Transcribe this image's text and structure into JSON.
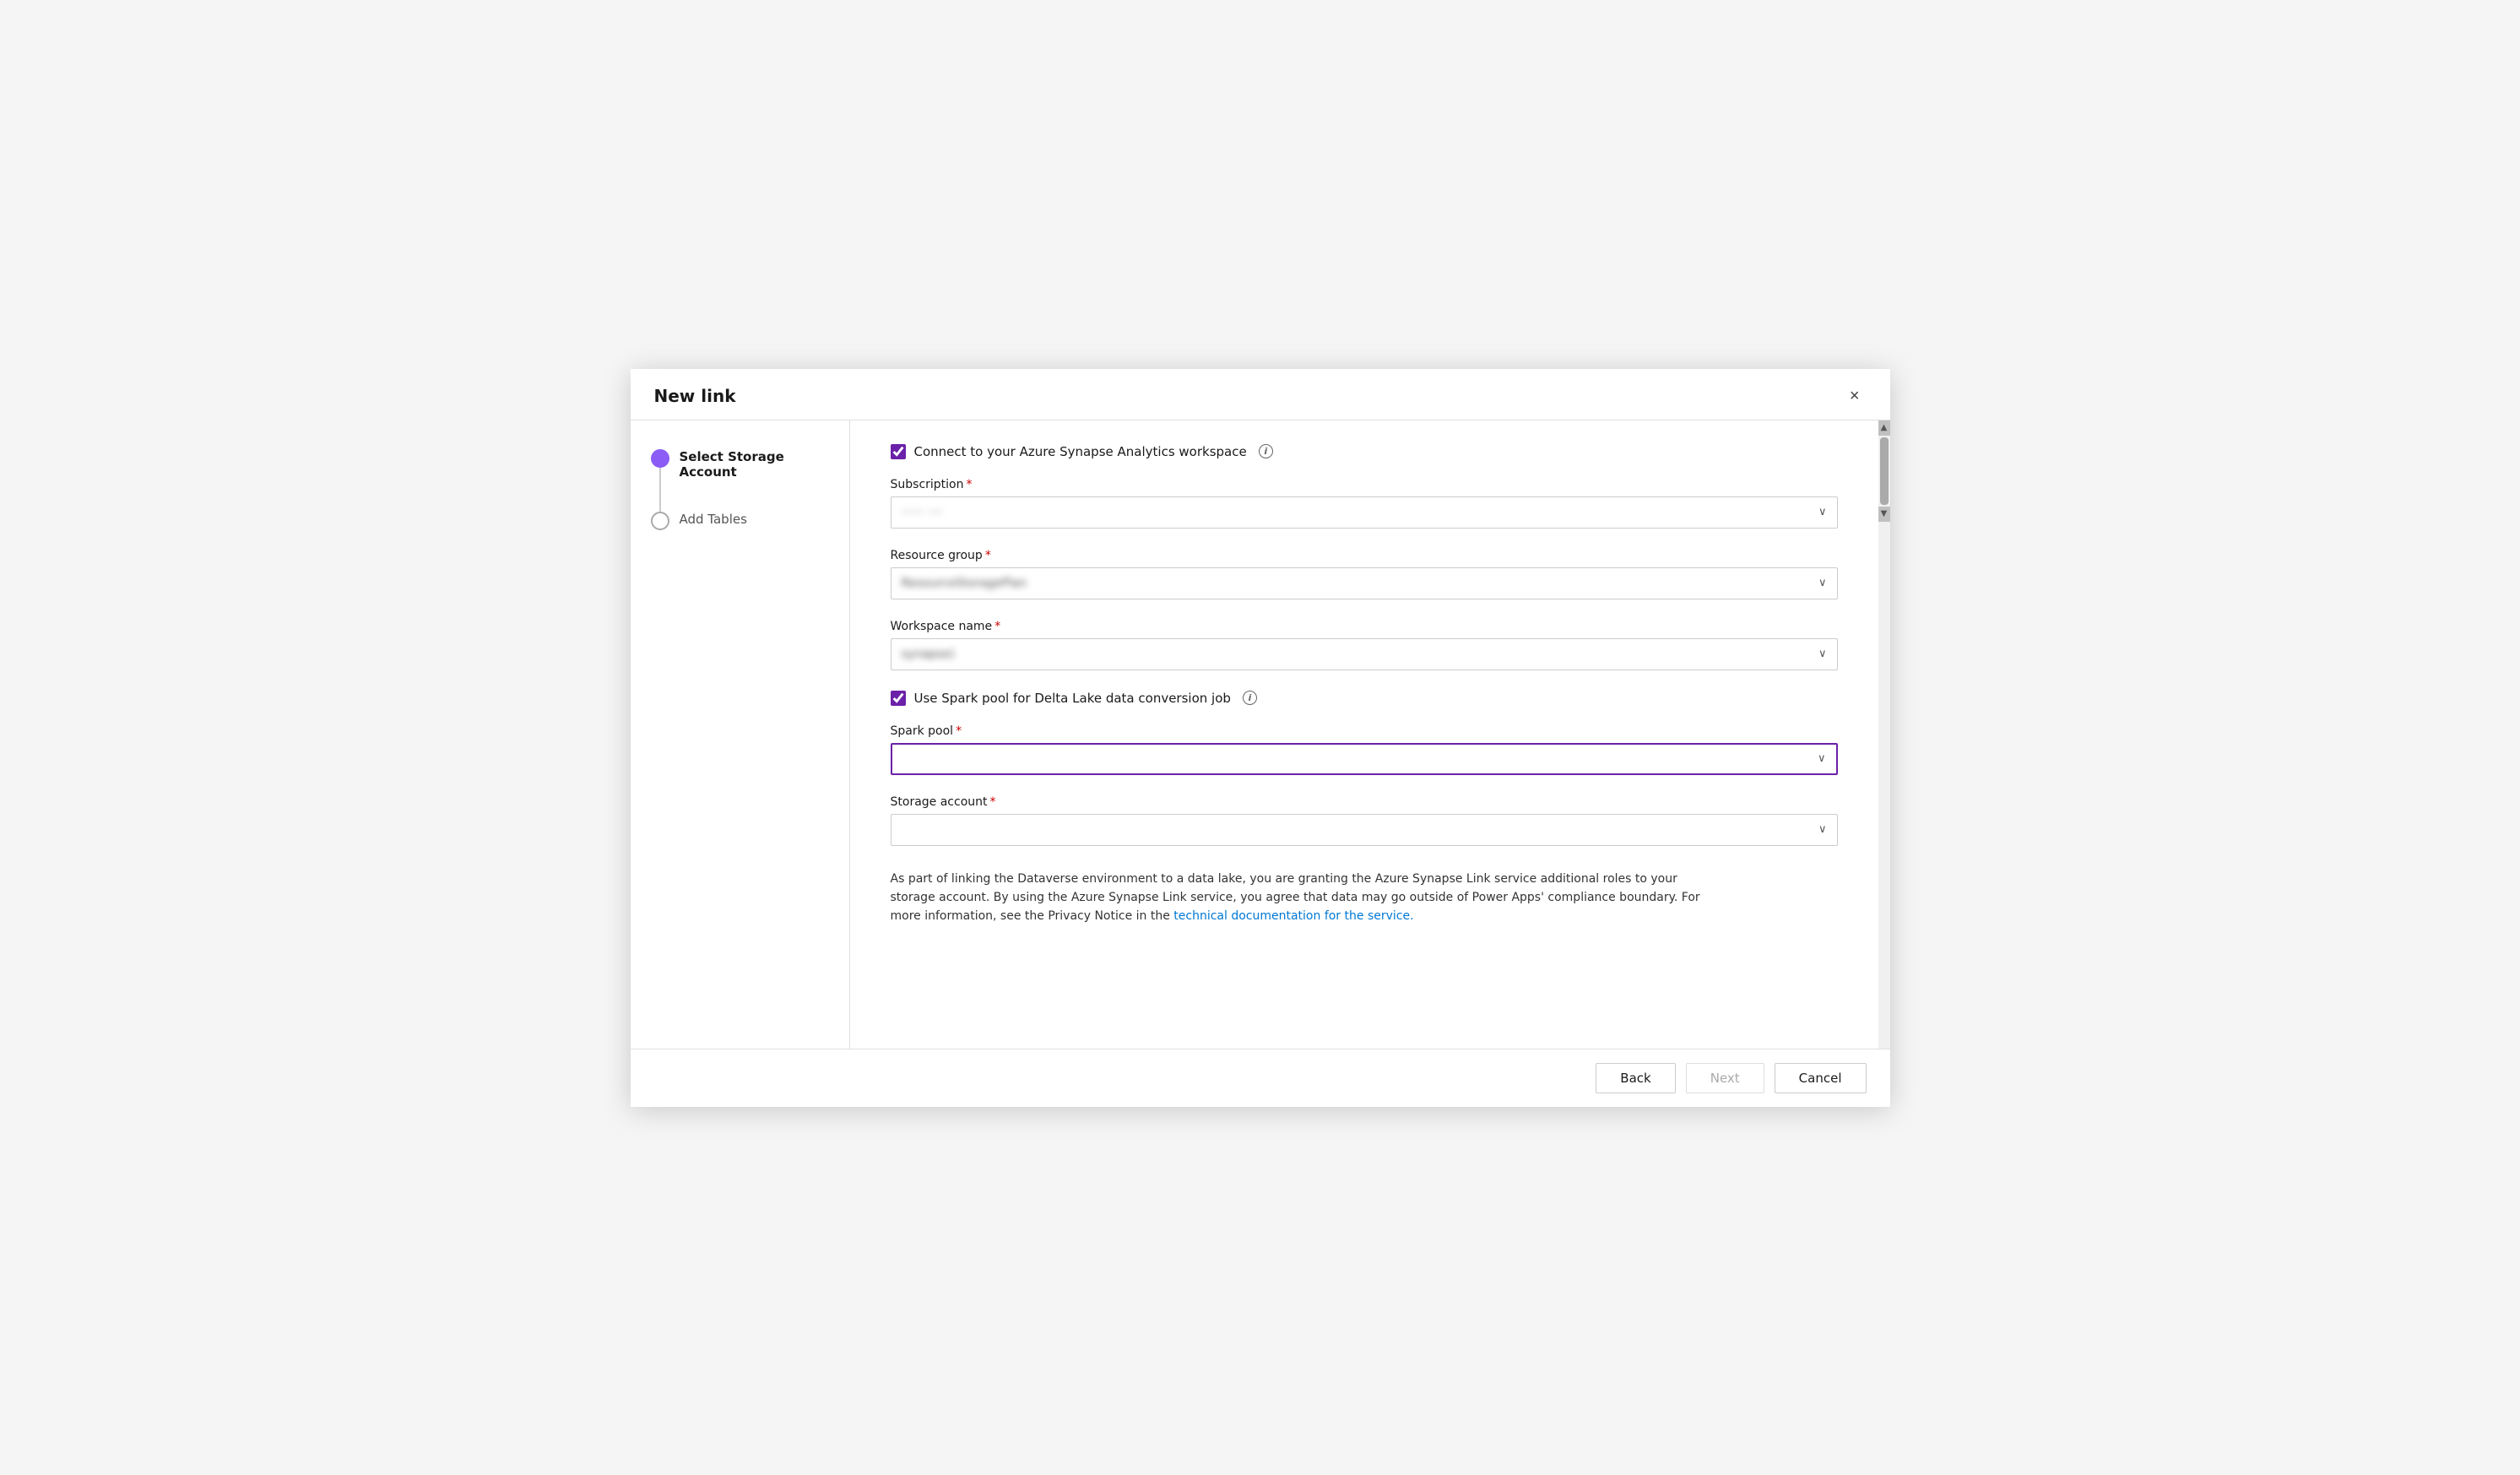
{
  "dialog": {
    "title": "New link",
    "close_label": "×"
  },
  "sidebar": {
    "steps": [
      {
        "id": "step-select-storage",
        "label": "Select Storage Account",
        "state": "active"
      },
      {
        "id": "step-add-tables",
        "label": "Add Tables",
        "state": "inactive"
      }
    ]
  },
  "form": {
    "connect_checkbox_label": "Connect to your Azure Synapse Analytics workspace",
    "connect_checked": true,
    "subscription_label": "Subscription",
    "subscription_required": true,
    "subscription_value": "······ ····",
    "resource_group_label": "Resource group",
    "resource_group_required": true,
    "resource_group_value": "ResourceStoragePlan",
    "workspace_name_label": "Workspace name",
    "workspace_name_required": true,
    "workspace_name_value": "synapse)",
    "spark_pool_checkbox_label": "Use Spark pool for Delta Lake data conversion job",
    "spark_pool_checked": true,
    "spark_pool_label": "Spark pool",
    "spark_pool_required": true,
    "spark_pool_value": "",
    "storage_account_label": "Storage account",
    "storage_account_required": true,
    "storage_account_value": "",
    "info_text_part1": "As part of linking the Dataverse environment to a data lake, you are granting the Azure Synapse Link service additional roles to your storage account. By using the Azure Synapse Link service, you agree that data may go outside of Power Apps' compliance boundary. For more information, see the Privacy Notice in the ",
    "info_link_text": "technical documentation for the service.",
    "info_link_url": "#"
  },
  "footer": {
    "back_label": "Back",
    "next_label": "Next",
    "cancel_label": "Cancel"
  },
  "icons": {
    "chevron_down": "⌄",
    "info": "i",
    "close": "✕",
    "scroll_up": "▲",
    "scroll_down": "▼"
  }
}
